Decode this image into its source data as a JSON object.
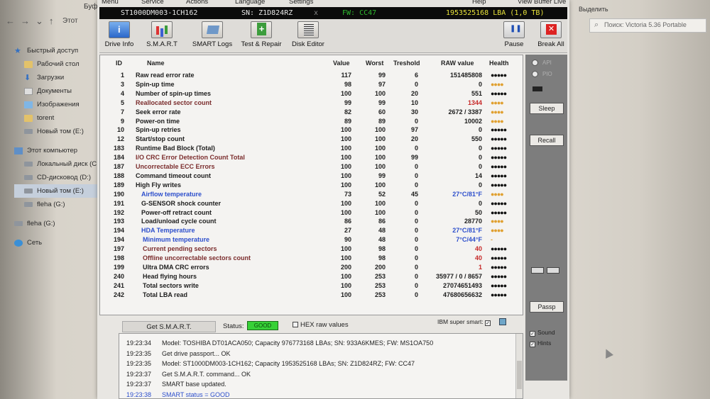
{
  "explorer": {
    "title_fragment": "Буф",
    "path_fragment": "Этот",
    "select_label": "Выделить",
    "search_placeholder": "Поиск: Victoria 5.36 Portable",
    "sidebar": [
      {
        "label": "Быстрый доступ",
        "icon": "star-icon"
      },
      {
        "label": "Рабочий стол",
        "icon": "folder-icon"
      },
      {
        "label": "Загрузки",
        "icon": "download-icon"
      },
      {
        "label": "Документы",
        "icon": "document-icon"
      },
      {
        "label": "Изображения",
        "icon": "image-icon"
      },
      {
        "label": "torent",
        "icon": "folder-icon"
      },
      {
        "label": "Новый том (E:)",
        "icon": "drive-icon"
      },
      {
        "label": "Этот компьютер",
        "icon": "computer-icon"
      },
      {
        "label": "Локальный диск (C:)",
        "icon": "drive-icon"
      },
      {
        "label": "CD-дисковод (D:)",
        "icon": "drive-icon"
      },
      {
        "label": "Новый том (E:)",
        "icon": "drive-icon"
      },
      {
        "label": "fleha (G:)",
        "icon": "drive-icon"
      },
      {
        "label": "fleha (G:)",
        "icon": "drive-icon"
      },
      {
        "label": "Сеть",
        "icon": "network-icon"
      }
    ]
  },
  "victoria": {
    "menu": [
      "Menu",
      "Service",
      "Actions",
      "Language",
      "Settings",
      "Help"
    ],
    "view_buffer": "View Buffer Live",
    "drive_model": "ST1000DM003-1CH162",
    "serial": "SN: Z1D824RZ",
    "firmware": "FW: CC47",
    "lba": "1953525168 LBA (1,0 TB)",
    "toolbar": {
      "drive_info": "Drive Info",
      "smart": "S.M.A.R.T",
      "smart_logs": "SMART Logs",
      "test_repair": "Test & Repair",
      "disk_editor": "Disk Editor",
      "pause": "Pause",
      "break_all": "Break All"
    },
    "columns": {
      "id": "ID",
      "name": "Name",
      "value": "Value",
      "worst": "Worst",
      "threshold": "Treshold",
      "raw": "RAW value",
      "health": "Health"
    },
    "rows": [
      {
        "id": "1",
        "name": "Raw read error rate",
        "value": "117",
        "worst": "99",
        "thr": "6",
        "raw": "151485808",
        "health": "●●●●●",
        "hstyle": "good",
        "nstyle": "",
        "rstyle": ""
      },
      {
        "id": "3",
        "name": "Spin-up time",
        "value": "98",
        "worst": "97",
        "thr": "0",
        "raw": "0",
        "health": "●●●●",
        "hstyle": "warn",
        "nstyle": "",
        "rstyle": ""
      },
      {
        "id": "4",
        "name": "Number of spin-up times",
        "value": "100",
        "worst": "100",
        "thr": "20",
        "raw": "551",
        "health": "●●●●●",
        "hstyle": "good",
        "nstyle": "",
        "rstyle": ""
      },
      {
        "id": "5",
        "name": "Reallocated sector count",
        "value": "99",
        "worst": "99",
        "thr": "10",
        "raw": "1344",
        "health": "●●●●",
        "hstyle": "warn",
        "nstyle": "brown",
        "rstyle": "red"
      },
      {
        "id": "7",
        "name": "Seek error rate",
        "value": "82",
        "worst": "60",
        "thr": "30",
        "raw": "2672 / 3387",
        "health": "●●●●",
        "hstyle": "warn",
        "nstyle": "",
        "rstyle": ""
      },
      {
        "id": "9",
        "name": "Power-on time",
        "value": "89",
        "worst": "89",
        "thr": "0",
        "raw": "10002",
        "health": "●●●●",
        "hstyle": "warn",
        "nstyle": "",
        "rstyle": ""
      },
      {
        "id": "10",
        "name": "Spin-up retries",
        "value": "100",
        "worst": "100",
        "thr": "97",
        "raw": "0",
        "health": "●●●●●",
        "hstyle": "good",
        "nstyle": "",
        "rstyle": ""
      },
      {
        "id": "12",
        "name": "Start/stop count",
        "value": "100",
        "worst": "100",
        "thr": "20",
        "raw": "550",
        "health": "●●●●●",
        "hstyle": "good",
        "nstyle": "",
        "rstyle": ""
      },
      {
        "id": "183",
        "name": "Runtime Bad Block (Total)",
        "value": "100",
        "worst": "100",
        "thr": "0",
        "raw": "0",
        "health": "●●●●●",
        "hstyle": "good",
        "nstyle": "",
        "rstyle": ""
      },
      {
        "id": "184",
        "name": "I/O CRC Error Detection Count Total",
        "value": "100",
        "worst": "100",
        "thr": "99",
        "raw": "0",
        "health": "●●●●●",
        "hstyle": "good",
        "nstyle": "brown",
        "rstyle": ""
      },
      {
        "id": "187",
        "name": "Uncorrectable ECC Errors",
        "value": "100",
        "worst": "100",
        "thr": "0",
        "raw": "0",
        "health": "●●●●●",
        "hstyle": "good",
        "nstyle": "brown",
        "rstyle": ""
      },
      {
        "id": "188",
        "name": "Command timeout count",
        "value": "100",
        "worst": "99",
        "thr": "0",
        "raw": "14",
        "health": "●●●●●",
        "hstyle": "good",
        "nstyle": "",
        "rstyle": ""
      },
      {
        "id": "189",
        "name": "High Fly writes",
        "value": "100",
        "worst": "100",
        "thr": "0",
        "raw": "0",
        "health": "●●●●●",
        "hstyle": "good",
        "nstyle": "",
        "rstyle": ""
      },
      {
        "id": "190",
        "name": "Airflow temperature",
        "value": "73",
        "worst": "52",
        "thr": "45",
        "raw": "27°C/81°F",
        "health": "●●●●",
        "hstyle": "warn",
        "nstyle": "blue",
        "rstyle": "blue"
      },
      {
        "id": "191",
        "name": "G-SENSOR shock counter",
        "value": "100",
        "worst": "100",
        "thr": "0",
        "raw": "0",
        "health": "●●●●●",
        "hstyle": "good",
        "nstyle": "",
        "rstyle": ""
      },
      {
        "id": "192",
        "name": "Power-off retract count",
        "value": "100",
        "worst": "100",
        "thr": "0",
        "raw": "50",
        "health": "●●●●●",
        "hstyle": "good",
        "nstyle": "",
        "rstyle": ""
      },
      {
        "id": "193",
        "name": "Load/unload cycle count",
        "value": "86",
        "worst": "86",
        "thr": "0",
        "raw": "28770",
        "health": "●●●●",
        "hstyle": "warn",
        "nstyle": "",
        "rstyle": ""
      },
      {
        "id": "194",
        "name": "HDA Temperature",
        "value": "27",
        "worst": "48",
        "thr": "0",
        "raw": "27°C/81°F",
        "health": "●●●●",
        "hstyle": "warn",
        "nstyle": "blue",
        "rstyle": "blue"
      },
      {
        "id": "194",
        "name": "Minimum temperature",
        "value": "90",
        "worst": "48",
        "thr": "0",
        "raw": "7°C/44°F",
        "health": "-",
        "hstyle": "warn",
        "nstyle": "blue",
        "rstyle": "blue"
      },
      {
        "id": "197",
        "name": "Current pending sectors",
        "value": "100",
        "worst": "98",
        "thr": "0",
        "raw": "40",
        "health": "●●●●●",
        "hstyle": "good",
        "nstyle": "brown",
        "rstyle": "red"
      },
      {
        "id": "198",
        "name": "Offline uncorrectable sectors count",
        "value": "100",
        "worst": "98",
        "thr": "0",
        "raw": "40",
        "health": "●●●●●",
        "hstyle": "good",
        "nstyle": "brown",
        "rstyle": "red"
      },
      {
        "id": "199",
        "name": "Ultra DMA CRC errors",
        "value": "200",
        "worst": "200",
        "thr": "0",
        "raw": "1",
        "health": "●●●●●",
        "hstyle": "good",
        "nstyle": "",
        "rstyle": "red"
      },
      {
        "id": "240",
        "name": "Head flying hours",
        "value": "100",
        "worst": "253",
        "thr": "0",
        "raw": "35977 / 0 / 8657",
        "health": "●●●●●",
        "hstyle": "good",
        "nstyle": "",
        "rstyle": ""
      },
      {
        "id": "241",
        "name": "Total sectors write",
        "value": "100",
        "worst": "253",
        "thr": "0",
        "raw": "27074651493",
        "health": "●●●●●",
        "hstyle": "good",
        "nstyle": "",
        "rstyle": ""
      },
      {
        "id": "242",
        "name": "Total LBA read",
        "value": "100",
        "worst": "253",
        "thr": "0",
        "raw": "47680656632",
        "health": "●●●●●",
        "hstyle": "good",
        "nstyle": "",
        "rstyle": ""
      }
    ],
    "side": {
      "radio1": "API",
      "radio2": "PIO",
      "sleep": "Sleep",
      "recall": "Recall",
      "passp": "Passp",
      "sound": "Sound",
      "hints": "Hints"
    },
    "status": {
      "get_smart": "Get S.M.A.R.T.",
      "label": "Status:",
      "value": "GOOD",
      "hex_raw": "HEX raw values",
      "ibm": "IBM super smart:"
    },
    "log": [
      {
        "time": "19:23:34",
        "text": "Model: TOSHIBA DT01ACA050; Capacity 976773168 LBAs; SN: 933A6KMES; FW: MS1OA750",
        "blue": false
      },
      {
        "time": "19:23:35",
        "text": "Get drive passport... OK",
        "blue": false
      },
      {
        "time": "19:23:35",
        "text": "Model: ST1000DM003-1CH162; Capacity 1953525168 LBAs; SN: Z1D824RZ; FW: CC47",
        "blue": false
      },
      {
        "time": "19:23:37",
        "text": "Get S.M.A.R.T. command... OK",
        "blue": false
      },
      {
        "time": "19:23:37",
        "text": "SMART base updated.",
        "blue": false
      },
      {
        "time": "19:23:38",
        "text": "SMART status = GOOD",
        "blue": true
      }
    ]
  }
}
